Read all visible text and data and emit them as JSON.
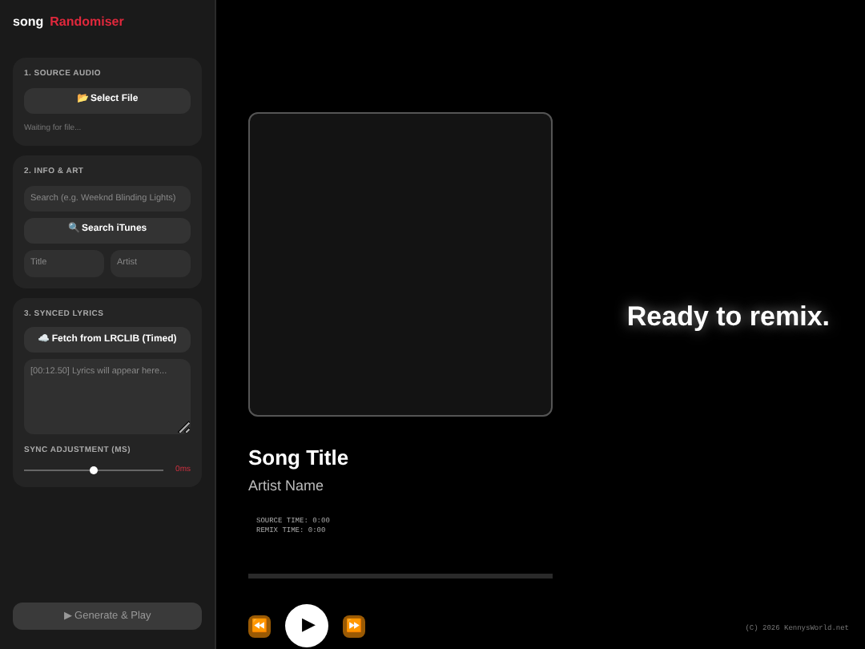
{
  "brand": {
    "word1": "song",
    "word2": "Randomiser"
  },
  "source": {
    "heading": "1. SOURCE AUDIO",
    "button": "📂 Select File",
    "status": "Waiting for file..."
  },
  "info": {
    "heading": "2. INFO & ART",
    "search": {
      "placeholder": "Search (e.g. Weeknd Blinding Lights)"
    },
    "button": "🔍 Search iTunes",
    "title_field": {
      "placeholder": "Title"
    },
    "artist_field": {
      "placeholder": "Artist"
    }
  },
  "lyrics": {
    "heading": "3. SYNCED LYRICS",
    "button": "☁️ Fetch from LRCLIB (Timed)",
    "textarea": {
      "placeholder": "[00:12.50] Lyrics will appear here..."
    },
    "sync_label": "SYNC ADJUSTMENT (MS)",
    "sync": {
      "level": 0.5
    },
    "sync_value": "0ms"
  },
  "generate_button": "▶ Generate & Play",
  "player": {
    "title": "Song Title",
    "artist": "Artist Name",
    "source_time": "SOURCE TIME: 0:00",
    "remix_time": "REMIX TIME: 0:00",
    "controls": [
      "⏪",
      "▶",
      "⏩"
    ]
  },
  "status": "Ready to remix.",
  "footer": "(C) 2026 KennysWorld.net"
}
